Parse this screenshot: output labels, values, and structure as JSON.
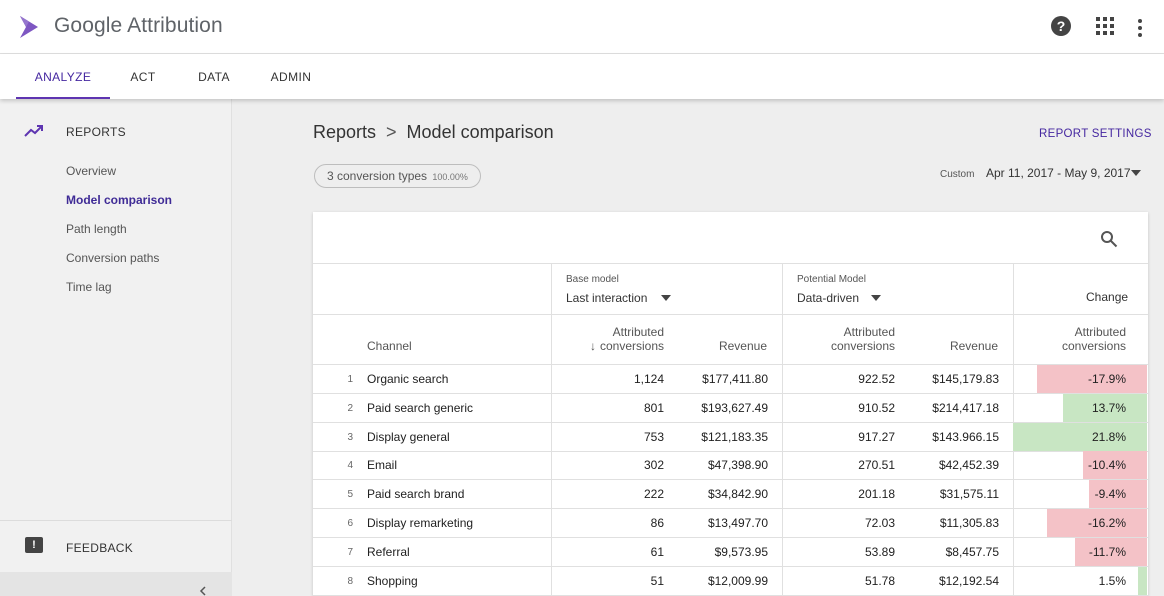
{
  "header": {
    "app_title": "Google Attribution",
    "icons": [
      "help-icon",
      "apps-icon",
      "more-vert-icon"
    ]
  },
  "nav": {
    "tabs": [
      "ANALYZE",
      "ACT",
      "DATA",
      "ADMIN"
    ],
    "active": "ANALYZE"
  },
  "sidebar": {
    "section": "REPORTS",
    "items": [
      "Overview",
      "Model comparison",
      "Path length",
      "Conversion paths",
      "Time lag"
    ],
    "active_item": "Model comparison",
    "feedback": "FEEDBACK",
    "feedback_glyph": "!"
  },
  "main": {
    "breadcrumb_root": "Reports",
    "breadcrumb_separator": ">",
    "breadcrumb_current": "Model comparison",
    "report_settings": "REPORT SETTINGS",
    "chip_label": "3 conversion types",
    "chip_percent": "100.00%",
    "date_label": "Custom",
    "date_range": "Apr 11, 2017 - May 9, 2017"
  },
  "table": {
    "base_model_label": "Base model",
    "base_model_value": "Last interaction",
    "potential_model_label": "Potential Model",
    "potential_model_value": "Data-driven",
    "change_label": "Change",
    "col_channel": "Channel",
    "col_attributed_l1": "Attributed",
    "col_attributed_l2": "conversions",
    "col_revenue": "Revenue",
    "sort_arrow": "↓",
    "rows": [
      {
        "idx": "1",
        "channel": "Organic search",
        "base_conv": "1,124",
        "base_rev": "$177,411.80",
        "pot_conv": "922.52",
        "pot_rev": "$145,179.83",
        "change": "-17.9%",
        "change_value": -17.9
      },
      {
        "idx": "2",
        "channel": "Paid search generic",
        "base_conv": "801",
        "base_rev": "$193,627.49",
        "pot_conv": "910.52",
        "pot_rev": "$214,417.18",
        "change": "13.7%",
        "change_value": 13.7
      },
      {
        "idx": "3",
        "channel": "Display general",
        "base_conv": "753",
        "base_rev": "$121,183.35",
        "pot_conv": "917.27",
        "pot_rev": "$143.966.15",
        "change": "21.8%",
        "change_value": 21.8
      },
      {
        "idx": "4",
        "channel": "Email",
        "base_conv": "302",
        "base_rev": "$47,398.90",
        "pot_conv": "270.51",
        "pot_rev": "$42,452.39",
        "change": "-10.4%",
        "change_value": -10.4
      },
      {
        "idx": "5",
        "channel": "Paid search brand",
        "base_conv": "222",
        "base_rev": "$34,842.90",
        "pot_conv": "201.18",
        "pot_rev": "$31,575.11",
        "change": "-9.4%",
        "change_value": -9.4
      },
      {
        "idx": "6",
        "channel": "Display remarketing",
        "base_conv": "86",
        "base_rev": "$13,497.70",
        "pot_conv": "72.03",
        "pot_rev": "$11,305.83",
        "change": "-16.2%",
        "change_value": -16.2
      },
      {
        "idx": "7",
        "channel": "Referral",
        "base_conv": "61",
        "base_rev": "$9,573.95",
        "pot_conv": "53.89",
        "pot_rev": "$8,457.75",
        "change": "-11.7%",
        "change_value": -11.7
      },
      {
        "idx": "8",
        "channel": "Shopping",
        "base_conv": "51",
        "base_rev": "$12,009.99",
        "pot_conv": "51.78",
        "pot_rev": "$12,192.54",
        "change": "1.5%",
        "change_value": 1.5
      }
    ]
  },
  "colors": {
    "accent": "#5e35b1",
    "negative": "#f4c2c7",
    "positive": "#c8e6c3"
  }
}
